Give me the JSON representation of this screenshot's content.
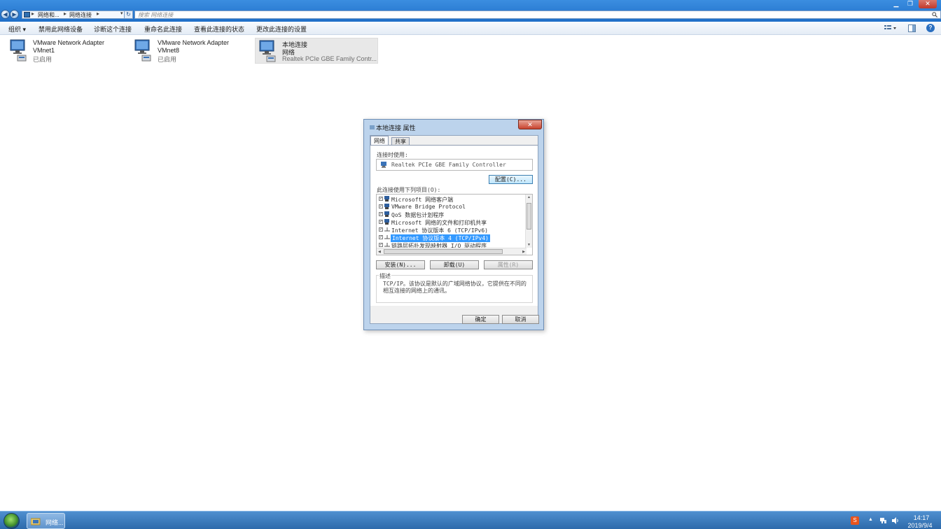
{
  "address": {
    "crumbs": [
      "网络和...",
      "网络连接"
    ],
    "search_placeholder": "搜索 网络连接"
  },
  "toolbar": {
    "organize": "组织 ▾",
    "disable": "禁用此网络设备",
    "diagnose": "诊断这个连接",
    "rename": "重命名此连接",
    "view_status": "查看此连接的状态",
    "change_settings": "更改此连接的设置"
  },
  "adapters": [
    {
      "name": "VMware Network Adapter",
      "line2": "VMnet1",
      "line3": "已启用"
    },
    {
      "name": "VMware Network Adapter",
      "line2": "VMnet8",
      "line3": "已启用"
    },
    {
      "name": "本地连接",
      "line2": "网络",
      "line3": "Realtek PCIe GBE Family Contr..."
    }
  ],
  "dialog": {
    "title": "本地连接 属性",
    "tabs": [
      "网络",
      "共享"
    ],
    "connect_using_label": "连接时使用:",
    "adapter_name": "Realtek PCIe GBE Family Controller",
    "configure_button": "配置(C)...",
    "items_label": "此连接使用下列项目(O):",
    "items": [
      {
        "label": "Microsoft 网络客户端",
        "checked": true
      },
      {
        "label": "VMware Bridge Protocol",
        "checked": true
      },
      {
        "label": "QoS 数据包计划程序",
        "checked": true
      },
      {
        "label": "Microsoft 网络的文件和打印机共享",
        "checked": true
      },
      {
        "label": "Internet 协议版本 6 (TCP/IPv6)",
        "checked": true
      },
      {
        "label": "Internet 协议版本 4 (TCP/IPv4)",
        "checked": true,
        "selected": true
      },
      {
        "label": "链路层拓扑发现映射器 I/O 驱动程序",
        "checked": true
      }
    ],
    "install_button": "安装(N)...",
    "uninstall_button": "卸载(U)",
    "properties_button": "属性(R)",
    "description_legend": "描述",
    "description_text": "TCP/IP。该协议是默认的广域网络协议，它提供在不同的相互连接的网络上的通讯。",
    "ok_button": "确定",
    "cancel_button": "取消"
  },
  "taskbar": {
    "explorer_label": "网络...",
    "time": "14:17",
    "date": "2019/9/4"
  },
  "colors": {
    "titlebar": "#2a7dd6",
    "selection": "#3399ff",
    "close": "#c8432f"
  }
}
